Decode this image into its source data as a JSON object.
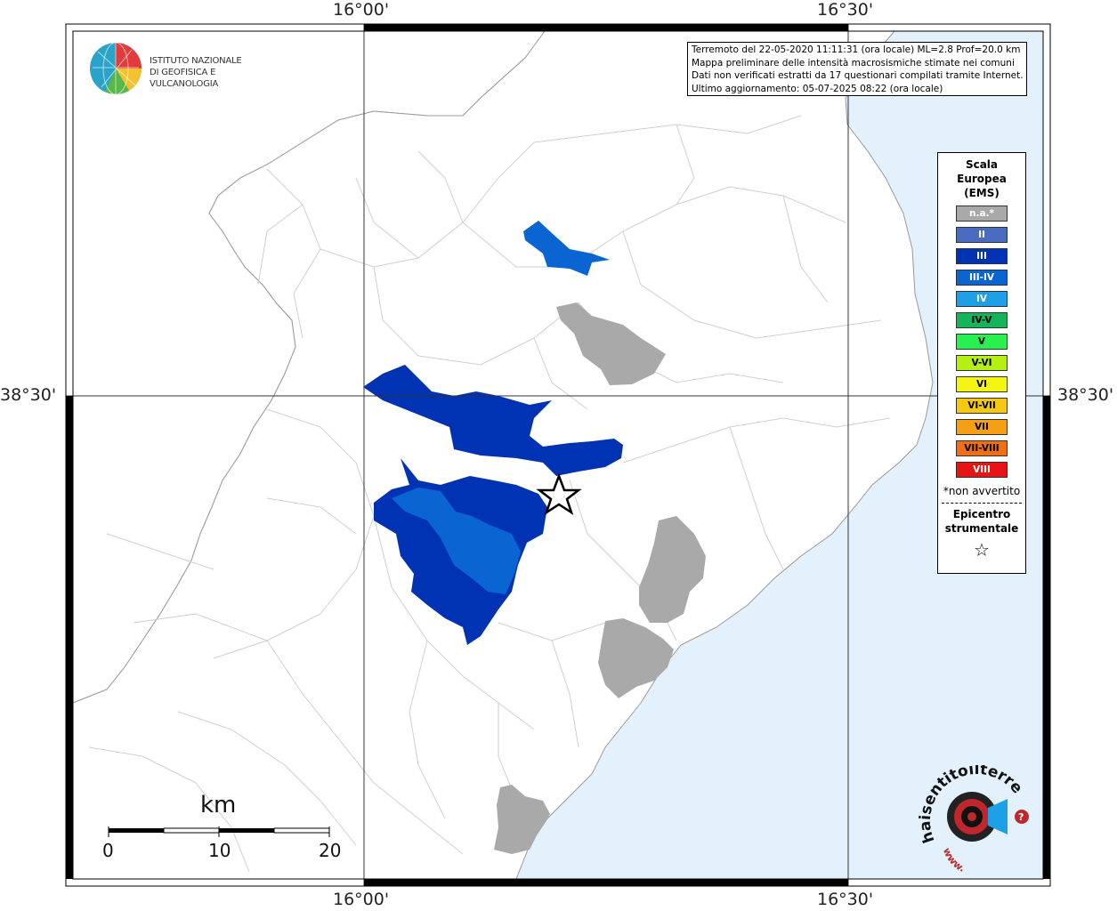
{
  "map": {
    "coords": {
      "top_left": "16°00'",
      "top_right": "16°30'",
      "bottom_left": "16°00'",
      "bottom_right": "16°30'",
      "left_lat": "38°30'",
      "right_lat": "38°30'"
    },
    "colors": {
      "sea": "#e2f1fb",
      "land": "#ffffff",
      "na": "#a9a9a9",
      "III": "#0032b4",
      "III-IV": "#0a64d2",
      "borders": "#c8c8c8"
    }
  },
  "logo": {
    "line1": "ISTITUTO NAZIONALE",
    "line2": "DI GEOFISICA E VULCANOLOGIA"
  },
  "info": {
    "line1": "Terremoto del 22-05-2020 11:11:31 (ora locale) ML=2.8 Prof=20.0 km",
    "line2": "Mappa preliminare delle intensità macrosismiche stimate nei comuni",
    "line3": "Dati non verificati estratti da 17 questionari compilati tramite Internet.",
    "line4": "Ultimo aggiornamento: 05-07-2025 08:22 (ora locale)"
  },
  "legend": {
    "title1": "Scala",
    "title2": "Europea",
    "title3": "(EMS)",
    "items": [
      {
        "label": "n.a.*",
        "color": "#a9a9a9",
        "text": "#ffffff"
      },
      {
        "label": "II",
        "color": "#4a6cc0",
        "text": "#ffffff"
      },
      {
        "label": "III",
        "color": "#0032b4",
        "text": "#ffffff"
      },
      {
        "label": "III-IV",
        "color": "#0a64d2",
        "text": "#ffffff"
      },
      {
        "label": "IV",
        "color": "#1ea0e6",
        "text": "#ffffff"
      },
      {
        "label": "IV-V",
        "color": "#14b45a",
        "text": "#000000"
      },
      {
        "label": "V",
        "color": "#28f050",
        "text": "#000000"
      },
      {
        "label": "V-VI",
        "color": "#b4f014",
        "text": "#000000"
      },
      {
        "label": "VI",
        "color": "#f5f514",
        "text": "#000000"
      },
      {
        "label": "VI-VII",
        "color": "#f5c814",
        "text": "#000000"
      },
      {
        "label": "VII",
        "color": "#f5a014",
        "text": "#000000"
      },
      {
        "label": "VII-VIII",
        "color": "#f06e14",
        "text": "#000000"
      },
      {
        "label": "VIII",
        "color": "#e61414",
        "text": "#ffffff"
      }
    ],
    "note": "*non avvertito",
    "epi1": "Epicentro",
    "epi2": "strumentale",
    "star": "☆"
  },
  "scale": {
    "unit": "km",
    "ticks": [
      "0",
      "10",
      "20"
    ]
  },
  "brand": {
    "name": "haisentitoilterremoto.it",
    "www": "www.",
    "q": "?"
  }
}
